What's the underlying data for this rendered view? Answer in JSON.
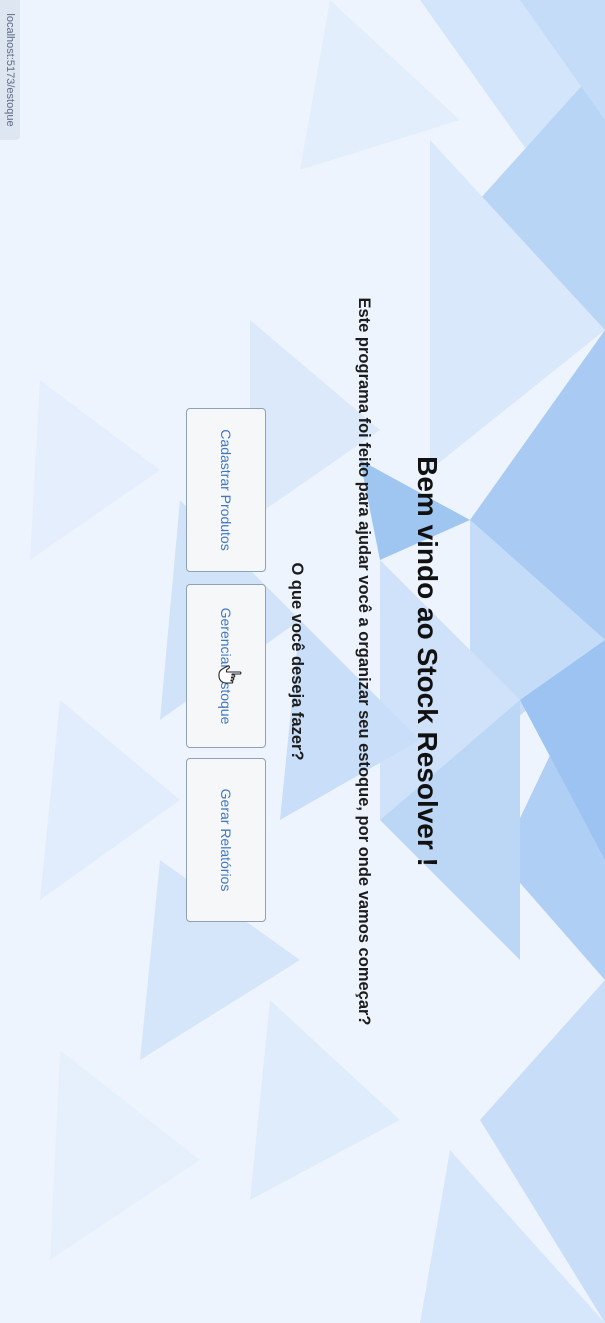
{
  "browser": {
    "url": "localhost:5173/estoque"
  },
  "main": {
    "title": "Bem vindo ao Stock Resolver !",
    "subtitle": "Este programa foi feito para ajudar você a organizar seu estoque, por onde vamos começar?",
    "question": "O que você deseja fazer?",
    "buttons": [
      {
        "label": "Cadastrar Produtos"
      },
      {
        "label": "Gerenciar Estoque"
      },
      {
        "label": "Gerar Relatórios"
      }
    ]
  },
  "cursor": {
    "icon": "hand-pointer-icon"
  },
  "colors": {
    "background": "#eef4fd",
    "triangle_light": "#d7e7fb",
    "triangle_mid": "#b3d1f5",
    "triangle_dark": "#8fbdf0",
    "button_text": "#3e77c2",
    "button_border": "#8fa1b7"
  }
}
